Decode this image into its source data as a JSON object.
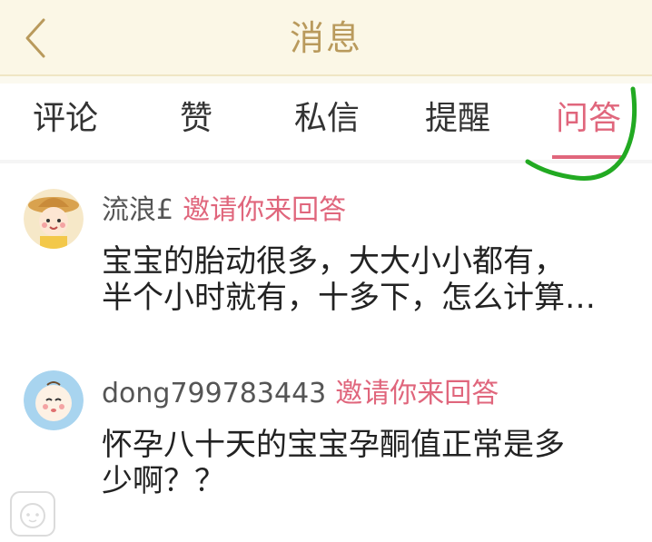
{
  "header": {
    "title": "消息",
    "back_icon": "chevron-left-icon"
  },
  "tabs": [
    {
      "label": "评论",
      "active": false
    },
    {
      "label": "赞",
      "active": false
    },
    {
      "label": "私信",
      "active": false
    },
    {
      "label": "提醒",
      "active": false
    },
    {
      "label": "问答",
      "active": true
    }
  ],
  "messages": [
    {
      "user": "流浪£",
      "action": "邀请你来回答",
      "avatar": "girl-with-hat-avatar",
      "content_lines": [
        "宝宝的胎动很多，大大小小都有，",
        "半个小时就有，十多下，怎么计算…"
      ]
    },
    {
      "user": "dong799783443",
      "action": "邀请你来回答",
      "avatar": "baby-avatar",
      "content_lines": [
        "怀孕八十天的宝宝孕酮值正常是多",
        "少啊？？"
      ]
    }
  ],
  "colors": {
    "accent": "#e0667c",
    "header_title": "#b99a5c",
    "header_bg": "#fbf7e6",
    "annotation": "#22aa22"
  }
}
